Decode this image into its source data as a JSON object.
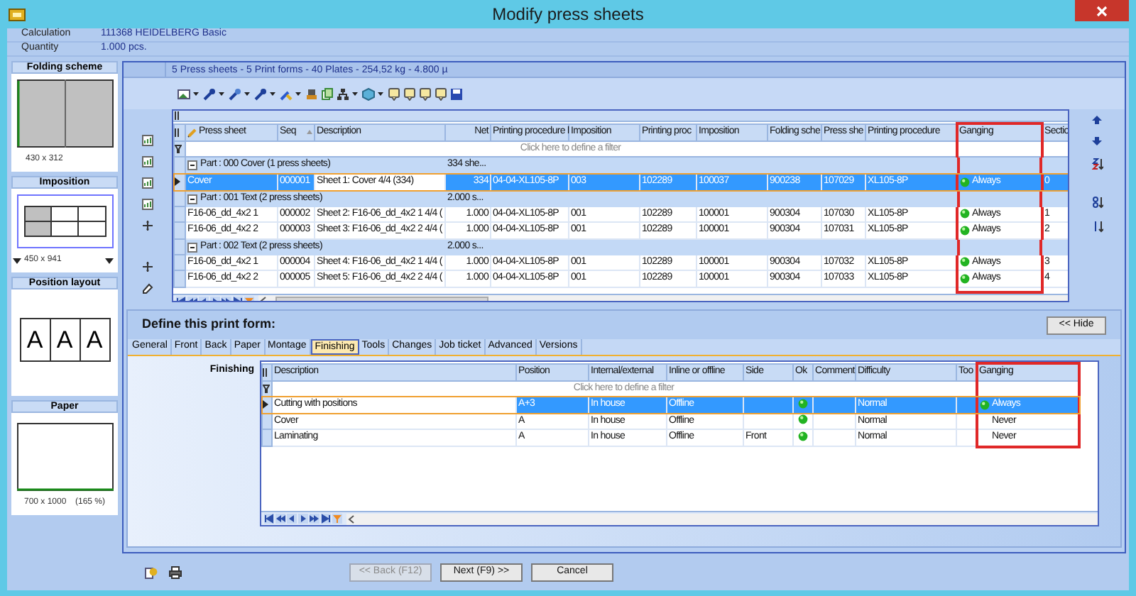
{
  "window": {
    "title": "Modify press sheets"
  },
  "header_fields": [
    {
      "label": "Calculation",
      "value": "111368 HEIDELBERG Basic"
    },
    {
      "label": "Quantity",
      "value": "1.000 pcs."
    }
  ],
  "sidebar": {
    "panels": [
      {
        "kind": "folding",
        "title": "Folding scheme",
        "caption": "430 x 312"
      },
      {
        "kind": "imposition",
        "title": "Imposition",
        "caption": "450 x 941"
      },
      {
        "kind": "positions",
        "title": "Position layout",
        "letters": [
          "A",
          "A",
          "A"
        ]
      },
      {
        "kind": "paper",
        "title": "Paper",
        "caption": "700 x 1000",
        "zoom": "(165 %)"
      }
    ]
  },
  "summary": "5 Press sheets - 5 Print forms - 40 Plates - 254,52 kg - 4.800 µ",
  "press_sheets_grid": {
    "columns": [
      {
        "label": "Press sheet",
        "kind": "text",
        "highlighted": false
      },
      {
        "label": "Seq",
        "kind": "text",
        "highlighted": false
      },
      {
        "label": "Description",
        "kind": "text",
        "highlighted": false,
        "focused": true
      },
      {
        "label": "Net",
        "kind": "number",
        "highlighted": false
      },
      {
        "label": "Printing procedure l",
        "kind": "text",
        "highlighted": false
      },
      {
        "label": "Imposition",
        "kind": "text",
        "highlighted": false
      },
      {
        "label": "Printing proc",
        "kind": "text",
        "highlighted": false
      },
      {
        "label": "Imposition",
        "kind": "text",
        "highlighted": false
      },
      {
        "label": "Folding sche",
        "kind": "text",
        "highlighted": false
      },
      {
        "label": "Press she",
        "kind": "text",
        "highlighted": false
      },
      {
        "label": "Printing procedure",
        "kind": "text",
        "highlighted": false
      },
      {
        "label": "Ganging",
        "kind": "indicator",
        "highlighted": true
      },
      {
        "label": "Sectio",
        "kind": "text",
        "highlighted": false
      }
    ],
    "filter_hint": "Click here to define a filter",
    "groups": [
      {
        "label": "Part : 000 Cover (1 press sheets)",
        "total": "334 she...",
        "expanded": true,
        "rows": [
          {
            "selected": true,
            "indicator": true,
            "cells": [
              "Cover",
              "000001",
              "Sheet 1: Cover 4/4 (334)",
              "334",
              "04-04-XL105-8P",
              "003",
              "102289",
              "100037",
              "900238",
              "107029",
              "XL105-8P",
              "Always",
              "0"
            ]
          }
        ]
      },
      {
        "label": "Part : 001 Text (2 press sheets)",
        "total": "2.000 s...",
        "expanded": true,
        "rows": [
          {
            "selected": false,
            "indicator": true,
            "cells": [
              "F16-06_dd_4x2 1",
              "000002",
              "Sheet 2: F16-06_dd_4x2 1 4/4 (",
              "1.000",
              "04-04-XL105-8P",
              "001",
              "102289",
              "100001",
              "900304",
              "107030",
              "XL105-8P",
              "Always",
              "1"
            ]
          },
          {
            "selected": false,
            "indicator": true,
            "cells": [
              "F16-06_dd_4x2 2",
              "000003",
              "Sheet 3: F16-06_dd_4x2 2 4/4 (",
              "1.000",
              "04-04-XL105-8P",
              "001",
              "102289",
              "100001",
              "900304",
              "107031",
              "XL105-8P",
              "Always",
              "2"
            ]
          }
        ]
      },
      {
        "label": "Part : 002 Text (2 press sheets)",
        "total": "2.000 s...",
        "expanded": true,
        "rows": [
          {
            "selected": false,
            "indicator": true,
            "cells": [
              "F16-06_dd_4x2 1",
              "000004",
              "Sheet 4: F16-06_dd_4x2 1 4/4 (",
              "1.000",
              "04-04-XL105-8P",
              "001",
              "102289",
              "100001",
              "900304",
              "107032",
              "XL105-8P",
              "Always",
              "3"
            ]
          },
          {
            "selected": false,
            "indicator": true,
            "cells": [
              "F16-06_dd_4x2 2",
              "000005",
              "Sheet 5: F16-06_dd_4x2 2 4/4 (",
              "1.000",
              "04-04-XL105-8P",
              "001",
              "102289",
              "100001",
              "900304",
              "107033",
              "XL105-8P",
              "Always",
              "4"
            ]
          }
        ]
      }
    ]
  },
  "print_form": {
    "title": "Define this print form:",
    "hide_button": "<< Hide",
    "tabs": [
      {
        "label": "General",
        "selected": false
      },
      {
        "label": "Front",
        "selected": false
      },
      {
        "label": "Back",
        "selected": false
      },
      {
        "label": "Paper",
        "selected": false
      },
      {
        "label": "Montage",
        "selected": false
      },
      {
        "label": "Finishing",
        "selected": true
      },
      {
        "label": "Tools",
        "selected": false
      },
      {
        "label": "Changes",
        "selected": false
      },
      {
        "label": "Job ticket",
        "selected": false
      },
      {
        "label": "Advanced",
        "selected": false
      },
      {
        "label": "Versions",
        "selected": false
      }
    ],
    "section_label": "Finishing",
    "grid": {
      "columns": [
        {
          "label": "Description",
          "kind": "text",
          "highlighted": false,
          "focused": true
        },
        {
          "label": "Position",
          "kind": "text",
          "highlighted": false
        },
        {
          "label": "Internal/external",
          "kind": "text",
          "highlighted": false
        },
        {
          "label": "Inline or offline",
          "kind": "text",
          "highlighted": false
        },
        {
          "label": "Side",
          "kind": "text",
          "highlighted": false
        },
        {
          "label": "Ok",
          "kind": "ok",
          "highlighted": false
        },
        {
          "label": "Comment",
          "kind": "text",
          "highlighted": false
        },
        {
          "label": "Difficulty",
          "kind": "text",
          "highlighted": false
        },
        {
          "label": "Too",
          "kind": "text",
          "highlighted": false
        },
        {
          "label": "Ganging",
          "kind": "indicator",
          "highlighted": true
        }
      ],
      "filter_hint": "Click here to define a filter",
      "rows": [
        {
          "selected": true,
          "ok": true,
          "indicator": true,
          "cells": [
            "Cutting with positions",
            "A+3",
            "In house",
            "Offline",
            "",
            "",
            "",
            "Normal",
            "",
            "Always"
          ]
        },
        {
          "selected": false,
          "ok": true,
          "indicator": false,
          "cells": [
            "Cover",
            "A",
            "In house",
            "Offline",
            "",
            "",
            "",
            "Normal",
            "",
            "Never"
          ]
        },
        {
          "selected": false,
          "ok": true,
          "indicator": false,
          "cells": [
            "Laminating",
            "A",
            "In house",
            "Offline",
            "Front",
            "",
            "",
            "Normal",
            "",
            "Never"
          ]
        }
      ]
    }
  },
  "buttons": [
    {
      "label": "<< Back (F12)",
      "disabled": true
    },
    {
      "label": "Next (F9) >>",
      "disabled": false
    },
    {
      "label": "Cancel",
      "disabled": false
    }
  ]
}
